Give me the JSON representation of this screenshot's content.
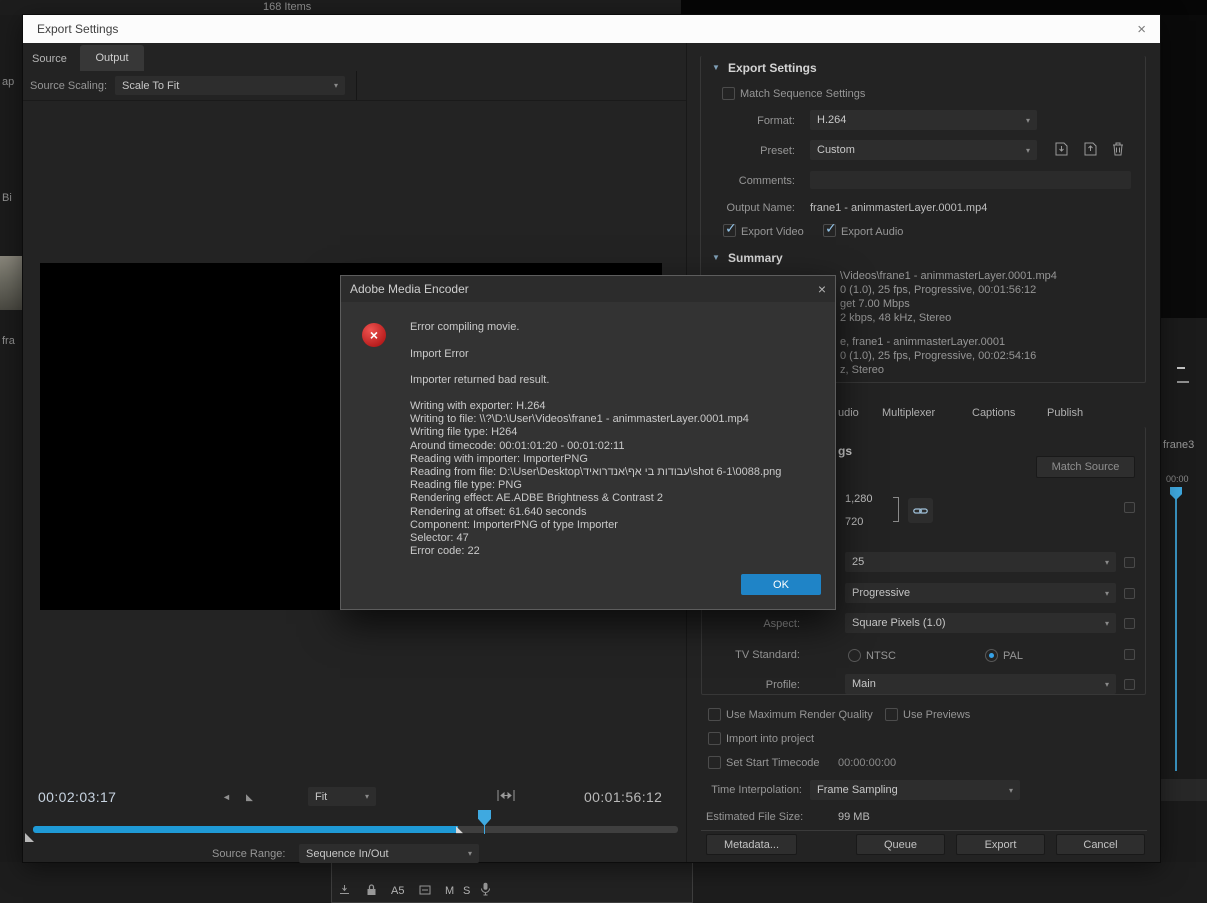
{
  "icons": {
    "collapse": "▼",
    "chevron": "▾",
    "check": "✓",
    "close": "×",
    "triangle_left": "◄",
    "triangle_corner": "◣"
  },
  "desktop": {
    "items_count": "168 Items",
    "left_fragments": [
      "ap",
      "Bi",
      "fra"
    ],
    "right_clip_name": "frane3",
    "right_ruler_start": "00:00",
    "track_controls": {
      "track_name": "A5",
      "mute": "M",
      "solo": "S"
    }
  },
  "window": {
    "title": "Export Settings",
    "tabs": {
      "source": "Source",
      "output": "Output"
    },
    "source_scaling": {
      "label": "Source Scaling:",
      "value": "Scale To Fit"
    },
    "transport": {
      "current_time": "00:02:03:17",
      "out_time": "00:01:56:12",
      "zoom_value": "Fit",
      "source_range_label": "Source Range:",
      "source_range_value": "Sequence In/Out"
    }
  },
  "export": {
    "header": "Export Settings",
    "match_sequence_label": "Match Sequence Settings",
    "format": {
      "label": "Format:",
      "value": "H.264"
    },
    "preset": {
      "label": "Preset:",
      "value": "Custom"
    },
    "comments_label": "Comments:",
    "output_name": {
      "label": "Output Name:",
      "value": "frane1 - animmasterLayer.0001.mp4"
    },
    "export_video_label": "Export Video",
    "export_audio_label": "Export Audio",
    "summary": {
      "header": "Summary",
      "lines": [
        "\\Videos\\frane1 - animmasterLayer.0001.mp4",
        "0 (1.0), 25 fps, Progressive, 00:01:56:12",
        "get 7.00 Mbps",
        "2 kbps, 48 kHz, Stereo",
        "e, frane1 - animmasterLayer.0001",
        "0 (1.0), 25 fps, Progressive, 00:02:54:16",
        "z, Stereo"
      ]
    },
    "tabs": [
      "udio",
      "Multiplexer",
      "Captions",
      "Publish"
    ],
    "video": {
      "header_fragment": "gs",
      "match_source_label": "Match Source",
      "width": "1,280",
      "height": "720",
      "frame_rate": "25",
      "field_order": "Progressive",
      "aspect_label": "Aspect:",
      "aspect_value": "Square Pixels (1.0)",
      "tv_standard_label": "TV Standard:",
      "ntsc_label": "NTSC",
      "pal_label": "PAL",
      "profile_label": "Profile:",
      "profile_value": "Main"
    },
    "options": {
      "max_quality": "Use Maximum Render Quality",
      "use_previews": "Use Previews",
      "import_project": "Import into project",
      "set_start_timecode": "Set Start Timecode",
      "start_timecode": "00:00:00:00",
      "time_interpolation_label": "Time Interpolation:",
      "time_interpolation_value": "Frame Sampling",
      "estimated_label": "Estimated File Size:",
      "estimated_value": "99 MB"
    },
    "buttons": {
      "metadata": "Metadata...",
      "queue": "Queue",
      "export": "Export",
      "cancel": "Cancel"
    }
  },
  "dialog": {
    "title": "Adobe Media Encoder",
    "message1": "Error compiling movie.",
    "message2": "Import Error",
    "message3": "Importer returned bad result.",
    "details": [
      "Writing with exporter: H.264",
      "Writing to file: \\\\?\\D:\\User\\Videos\\frane1 - animmasterLayer.0001.mp4",
      "Writing file type: H264",
      "Around timecode: 00:01:01:20 - 00:01:02:11",
      "Reading with importer: ImporterPNG",
      "Reading from file: D:\\User\\Desktop\\עבודות בי אף\\אנדרואיד\\shot 6-1\\0088.png",
      "Reading file type: PNG",
      "Rendering effect: AE.ADBE Brightness & Contrast 2",
      "Rendering at offset: 61.640 seconds",
      "Component: ImporterPNG of type Importer",
      "Selector: 47",
      "Error code: 22"
    ],
    "ok_label": "OK"
  }
}
